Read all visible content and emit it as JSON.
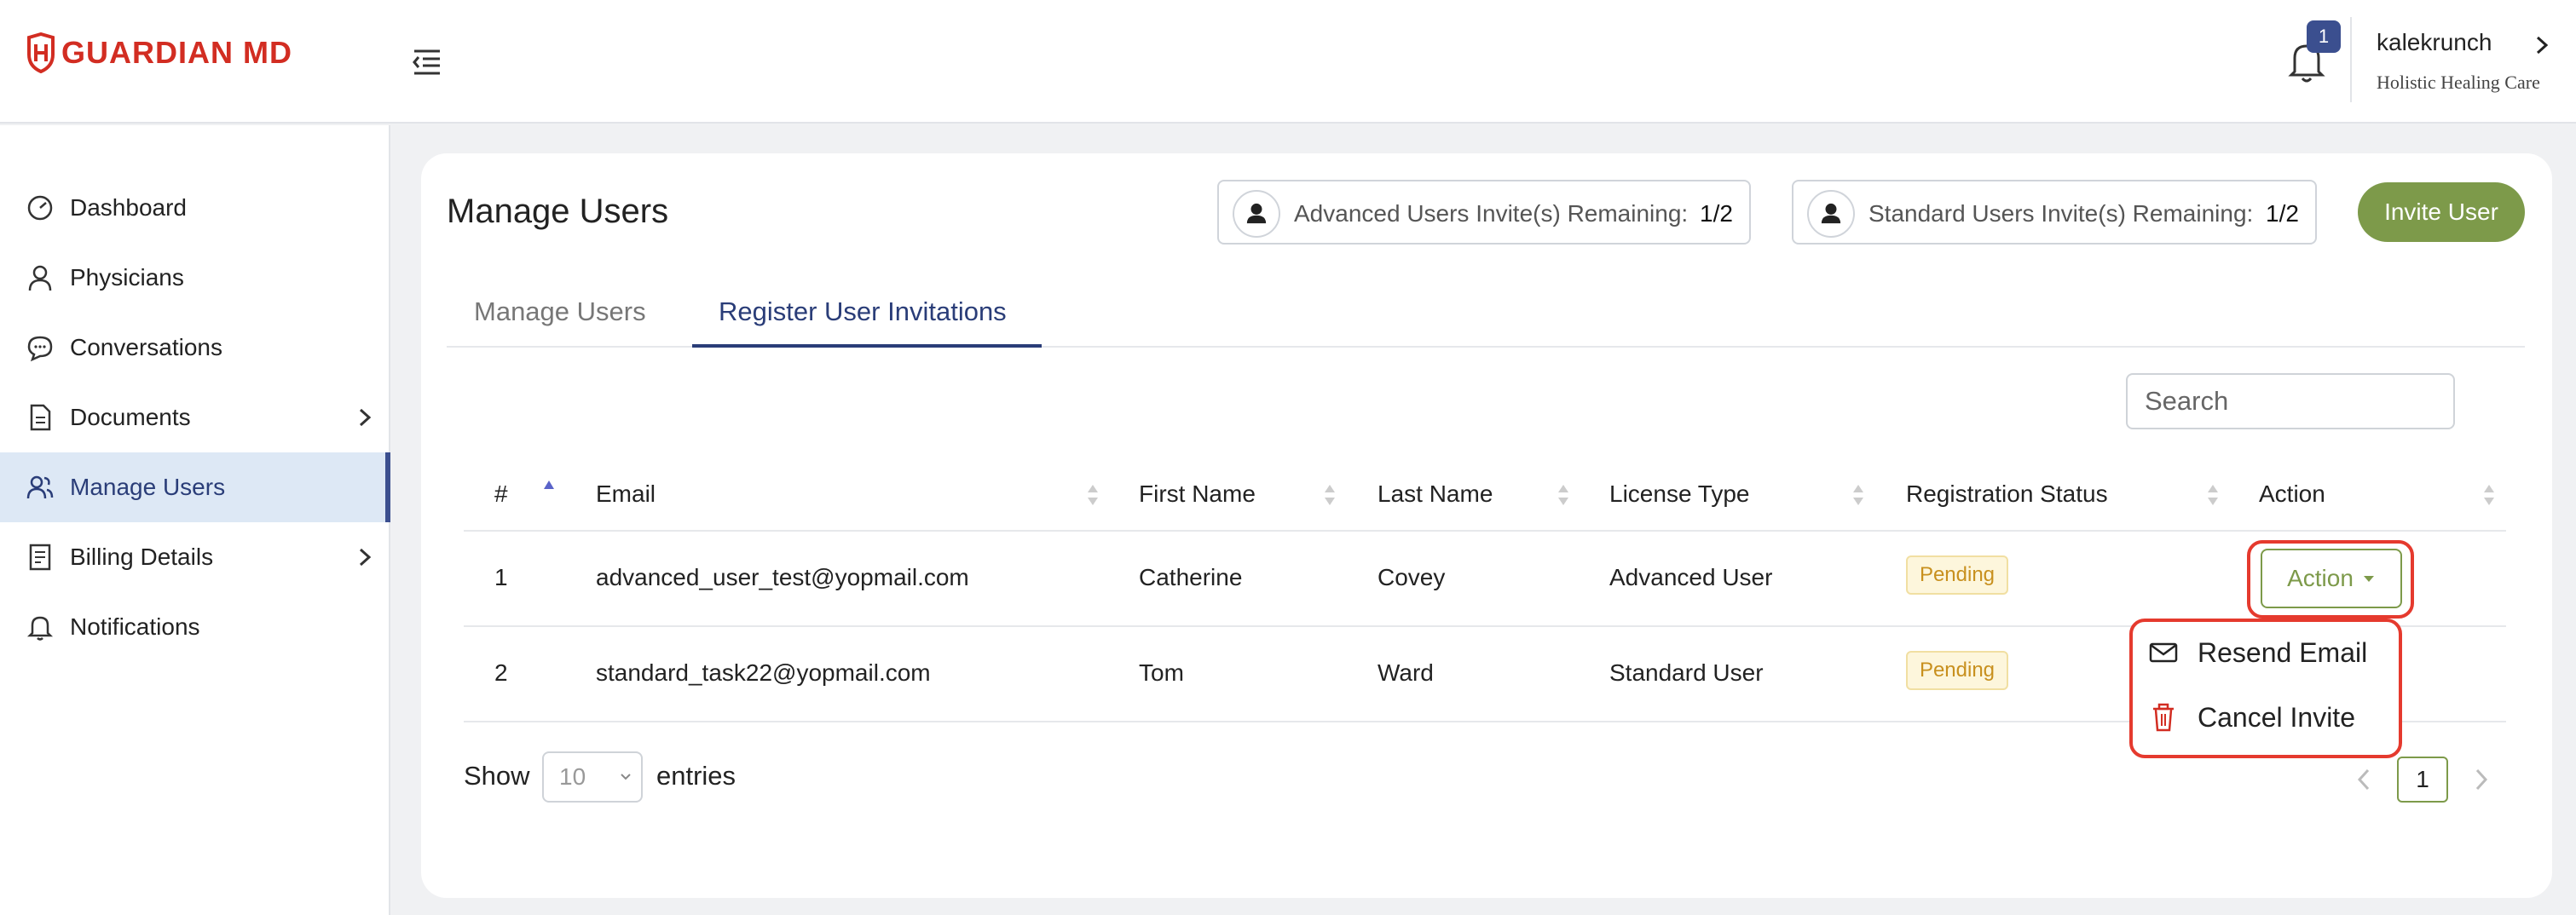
{
  "header": {
    "brand": "GUARDIAN MD",
    "notification_count": "1",
    "user_name": "kalekrunch",
    "organization": "Holistic Healing Care"
  },
  "sidebar": {
    "items": [
      {
        "label": "Dashboard",
        "icon": "dashboard-gauge-icon"
      },
      {
        "label": "Physicians",
        "icon": "person-icon"
      },
      {
        "label": "Conversations",
        "icon": "chat-bubble-icon"
      },
      {
        "label": "Documents",
        "icon": "document-icon",
        "expandable": true
      },
      {
        "label": "Manage Users",
        "icon": "users-icon",
        "active": true
      },
      {
        "label": "Billing Details",
        "icon": "billing-icon",
        "expandable": true
      },
      {
        "label": "Notifications",
        "icon": "bell-icon"
      }
    ]
  },
  "main": {
    "title": "Manage Users",
    "advanced_quota": {
      "label": "Advanced Users Invite(s) Remaining:",
      "value": "1/2"
    },
    "standard_quota": {
      "label": "Standard Users Invite(s) Remaining:",
      "value": "1/2"
    },
    "invite_button": "Invite User",
    "tabs": [
      {
        "label": "Manage Users",
        "active": false
      },
      {
        "label": "Register User Invitations",
        "active": true
      }
    ],
    "search_placeholder": "Search",
    "table": {
      "columns": [
        "#",
        "Email",
        "First Name",
        "Last Name",
        "License Type",
        "Registration Status",
        "Action"
      ],
      "rows": [
        {
          "num": "1",
          "email": "advanced_user_test@yopmail.com",
          "first": "Catherine",
          "last": "Covey",
          "license": "Advanced User",
          "status": "Pending"
        },
        {
          "num": "2",
          "email": "standard_task22@yopmail.com",
          "first": "Tom",
          "last": "Ward",
          "license": "Standard User",
          "status": "Pending"
        }
      ]
    },
    "action_button": "Action",
    "action_menu": [
      {
        "label": "Resend Email",
        "icon": "envelope-icon"
      },
      {
        "label": "Cancel Invite",
        "icon": "trash-icon"
      }
    ],
    "footer": {
      "show_label": "Show",
      "entries_value": "10",
      "entries_label": "entries",
      "current_page": "1"
    }
  },
  "colors": {
    "brand_red": "#d22d22",
    "primary_green": "#7d9a4a",
    "nav_blue": "#2a3d78",
    "highlight_red": "#e53a2e",
    "pending_text": "#c8901e"
  }
}
